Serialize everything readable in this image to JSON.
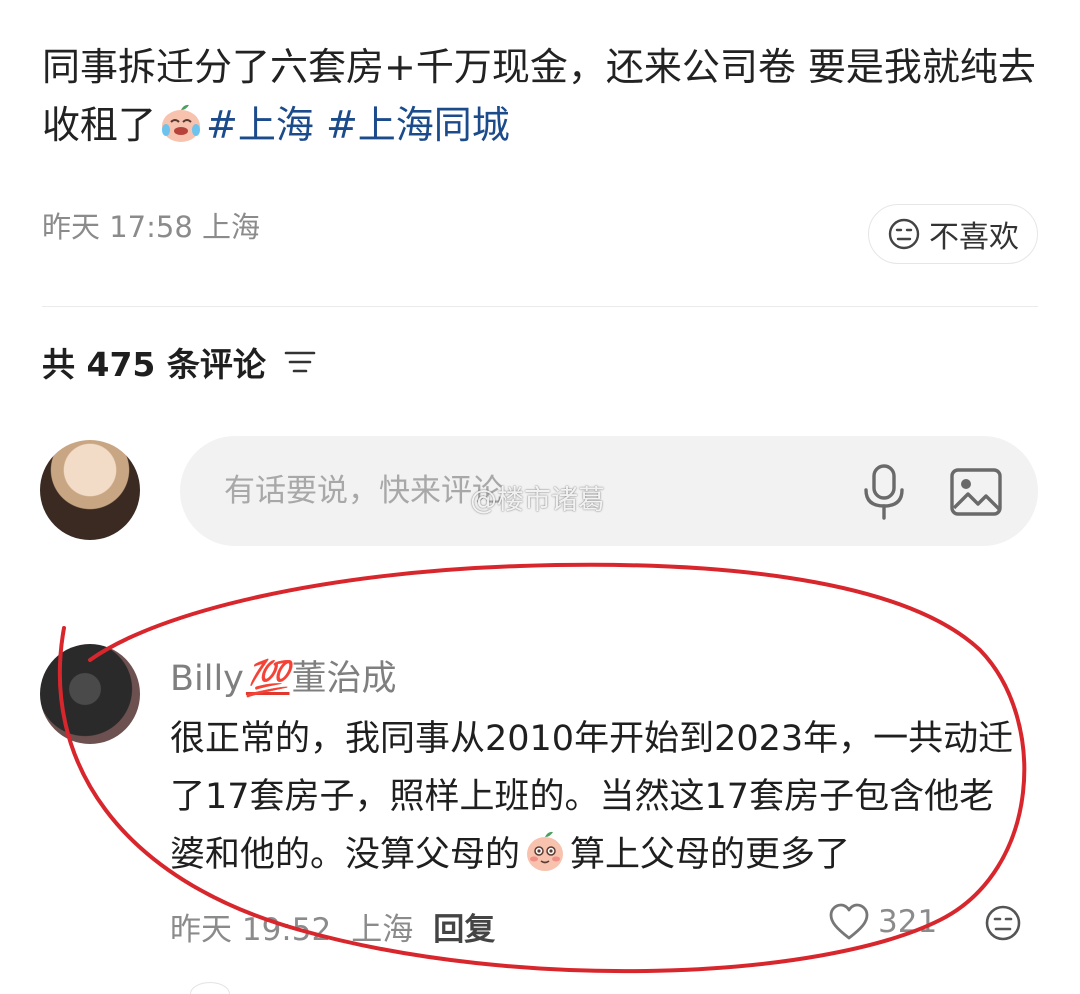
{
  "post": {
    "text_part1": "同事拆迁分了六套房+千万现金，还来公司卷 要是我就纯去收租了",
    "hashtag1": "#上海",
    "hashtag2": "#上海同城",
    "emoji1": "crying-laughing-peach-emoji",
    "time": "昨天 17:58",
    "location": "上海",
    "dislike_label": "不喜欢"
  },
  "comments_header": {
    "label": "共 475 条评论",
    "sort_icon": "filter-lines-icon"
  },
  "composer": {
    "placeholder": "有话要说，快来评论",
    "mic_icon": "microphone-icon",
    "image_icon": "image-icon"
  },
  "watermark": "@楼市诸葛",
  "comment": {
    "user_name": "Billy",
    "badge": "💯",
    "user_name_suffix": "董治成",
    "text_part1": "很正常的，我同事从2010年开始到2023年，一共动迁了17套房子，照样上班的。当然这17套房子包含他老婆和他的。没算父母的",
    "emoji": "shy-peach-emoji",
    "text_part2": "算上父母的更多了",
    "time": "昨天 19:52",
    "location": "上海",
    "reply_label": "回复",
    "likes": "321"
  },
  "colors": {
    "hashtag": "#1c4b8c",
    "annotation_red": "#d8262d",
    "meta_gray": "#8b8b8b"
  }
}
